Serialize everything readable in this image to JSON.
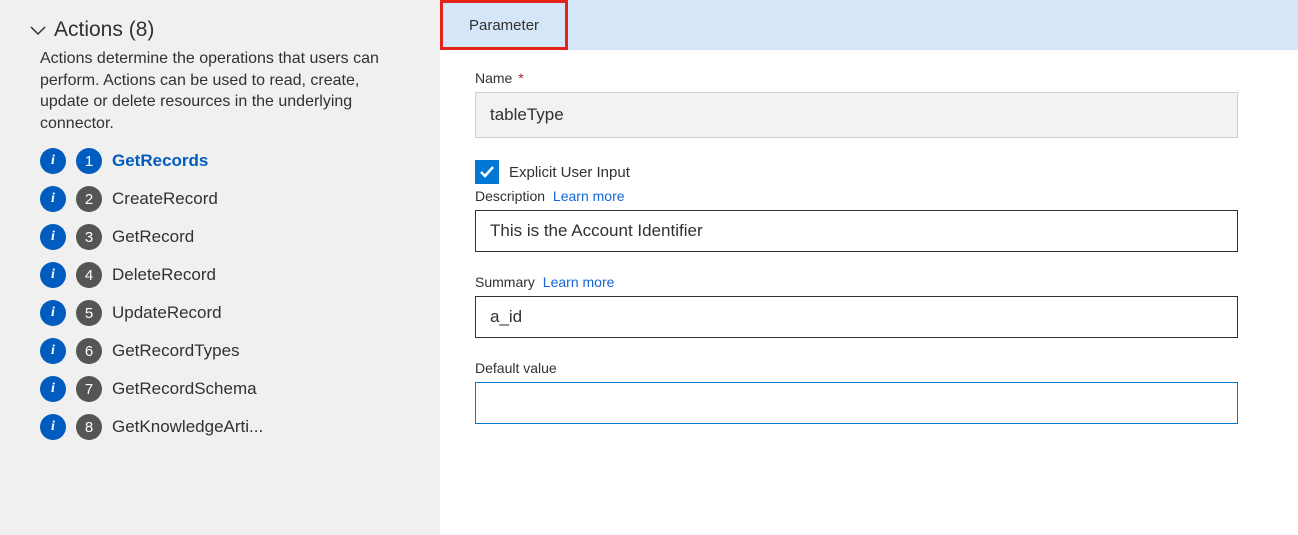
{
  "sidebar": {
    "title": "Actions (8)",
    "description": "Actions determine the operations that users can perform. Actions can be used to read, create, update or delete resources in the underlying connector.",
    "items": [
      {
        "num": "1",
        "label": "GetRecords",
        "active": true
      },
      {
        "num": "2",
        "label": "CreateRecord",
        "active": false
      },
      {
        "num": "3",
        "label": "GetRecord",
        "active": false
      },
      {
        "num": "4",
        "label": "DeleteRecord",
        "active": false
      },
      {
        "num": "5",
        "label": "UpdateRecord",
        "active": false
      },
      {
        "num": "6",
        "label": "GetRecordTypes",
        "active": false
      },
      {
        "num": "7",
        "label": "GetRecordSchema",
        "active": false
      },
      {
        "num": "8",
        "label": "GetKnowledgeArti...",
        "active": false
      }
    ]
  },
  "main": {
    "tab_label": "Parameter",
    "name_label": "Name",
    "name_value": "tableType",
    "explicit_label": "Explicit User Input",
    "explicit_checked": true,
    "description_label": "Description",
    "description_value": "This is the Account Identifier",
    "summary_label": "Summary",
    "summary_value": "a_id",
    "default_label": "Default value",
    "default_value": "",
    "learn_more": "Learn more"
  }
}
